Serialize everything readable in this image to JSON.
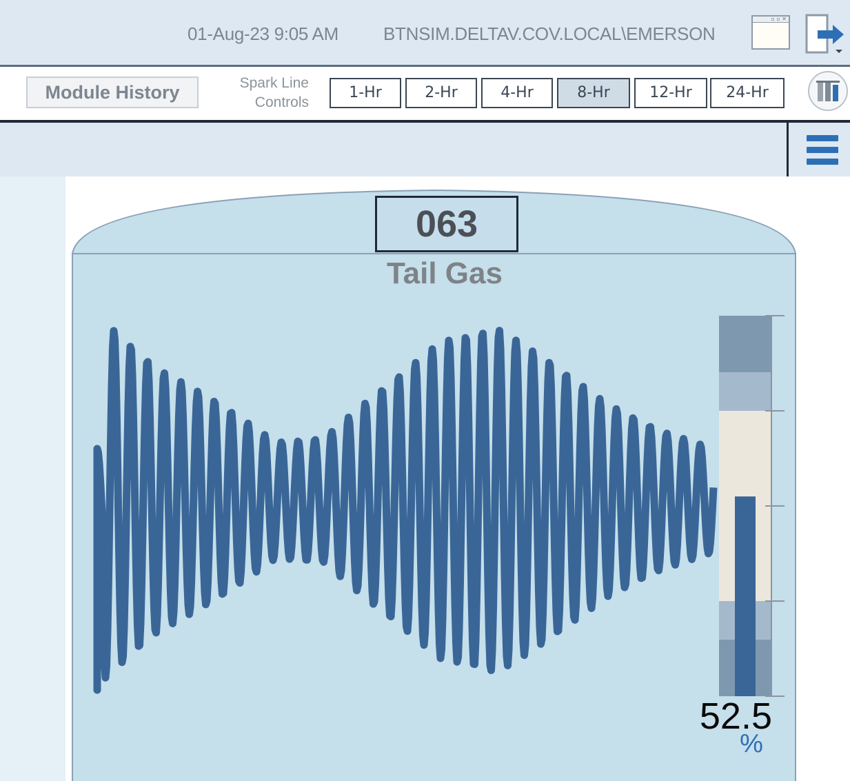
{
  "header": {
    "datetime": "01-Aug-23 9:05 AM",
    "user": "BTNSIM.DELTAV.COV.LOCAL\\EMERSON",
    "window_icon": "window-icon",
    "logout_icon": "logout-arrow-icon"
  },
  "toolbar": {
    "module_history_label": "Module History",
    "spark_label_line1": "Spark Line",
    "spark_label_line2": "Controls",
    "ranges": [
      "1-Hr",
      "2-Hr",
      "4-Hr",
      "8-Hr",
      "12-Hr",
      "24-Hr"
    ],
    "selected_range": "8-Hr",
    "trend_icon": "trend-bars-icon"
  },
  "menu": {
    "icon": "hamburger-menu-icon"
  },
  "faceplate": {
    "tag": "063",
    "description": "Tail Gas",
    "pv": "52.5",
    "unit": "%",
    "bar_level_percent": 52.5,
    "colors": {
      "panel": "#c5dfeb",
      "trend": "#3a6697",
      "bar": "#3a6697",
      "alarm_outer": "#7e98b0",
      "alarm_inner": "#a5b9cd",
      "normal_band": "#ece7dd"
    }
  }
}
